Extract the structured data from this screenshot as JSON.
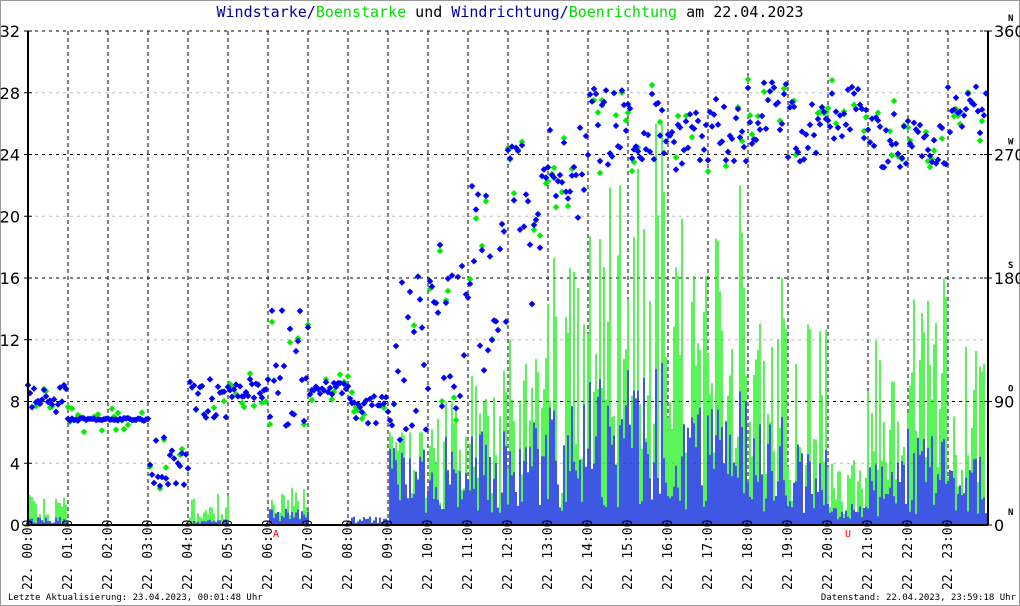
{
  "title": {
    "part1": "Windstarke",
    "sep1": "/",
    "part2": "Boenstarke",
    "part3": " und ",
    "part4": "Windrichtung",
    "sep2": "/",
    "part5": "Boenrichtung",
    "part6": " am 22.04.2023"
  },
  "footer": {
    "left": "Letzte Aktualisierung: 23.04.2023, 00:01:48 Uhr",
    "right": "Datenstand: 22.04.2023, 23:59:18 Uhr"
  },
  "colors": {
    "speed": "#0000ff",
    "gust": "#00ee00",
    "marker": "#ff0000"
  },
  "chart_data": {
    "type": "scatter",
    "title": "Windstarke/Boenstarke und Windrichtung/Boenrichtung am 22.04.2023",
    "y_left": {
      "range": [
        0,
        32
      ],
      "ticks": [
        "0",
        "4",
        "8",
        "12",
        "16",
        "20",
        "24",
        "28",
        "32"
      ]
    },
    "y_right": {
      "range": [
        0,
        360
      ],
      "ticks": [
        "0",
        "90",
        "180",
        "270",
        "360"
      ],
      "compass": [
        "N",
        "O",
        "S",
        "W",
        "N"
      ]
    },
    "x_ticks": [
      "22. 00:00",
      "22. 01:00",
      "22. 02:00",
      "22. 03:00",
      "22. 04:00",
      "22. 05:00",
      "22. 06:00",
      "22. 07:00",
      "22. 08:00",
      "22. 09:00",
      "22. 10:00",
      "22. 11:00",
      "22. 12:00",
      "22. 13:00",
      "22. 14:00",
      "22. 15:00",
      "22. 16:00",
      "22. 17:00",
      "22. 18:00",
      "22. 19:00",
      "22. 20:00",
      "22. 21:00",
      "22. 22:00",
      "22. 23:00"
    ],
    "markers": [
      {
        "label": "A",
        "hour": 6.2
      },
      {
        "label": "U",
        "hour": 20.5
      }
    ],
    "grid": true,
    "hourly": {
      "hour": [
        0,
        1,
        2,
        3,
        4,
        5,
        6,
        7,
        8,
        9,
        10,
        11,
        12,
        13,
        14,
        15,
        16,
        17,
        18,
        19,
        20,
        21,
        22,
        23
      ],
      "speed_mean": [
        0.3,
        0,
        0,
        0,
        0.2,
        0,
        0.6,
        0,
        0.3,
        3,
        3.5,
        3.5,
        4,
        4.5,
        5.5,
        6,
        5,
        5,
        4,
        3,
        0.8,
        2.5,
        3.5,
        2.5
      ],
      "gust_max": [
        2.5,
        0,
        0,
        0,
        2.5,
        0,
        2.5,
        0,
        0,
        6,
        8,
        10,
        12,
        20,
        24,
        26,
        22,
        22,
        16,
        13,
        5,
        13,
        18,
        13
      ],
      "direction_mean": [
        92,
        77,
        77,
        40,
        92,
        100,
        110,
        100,
        84,
        120,
        150,
        180,
        220,
        260,
        290,
        290,
        280,
        290,
        300,
        290,
        300,
        280,
        280,
        300
      ],
      "direction_spread": [
        20,
        2,
        2,
        50,
        30,
        15,
        100,
        10,
        20,
        130,
        130,
        140,
        120,
        80,
        60,
        50,
        50,
        50,
        50,
        50,
        40,
        40,
        40,
        40
      ]
    }
  }
}
